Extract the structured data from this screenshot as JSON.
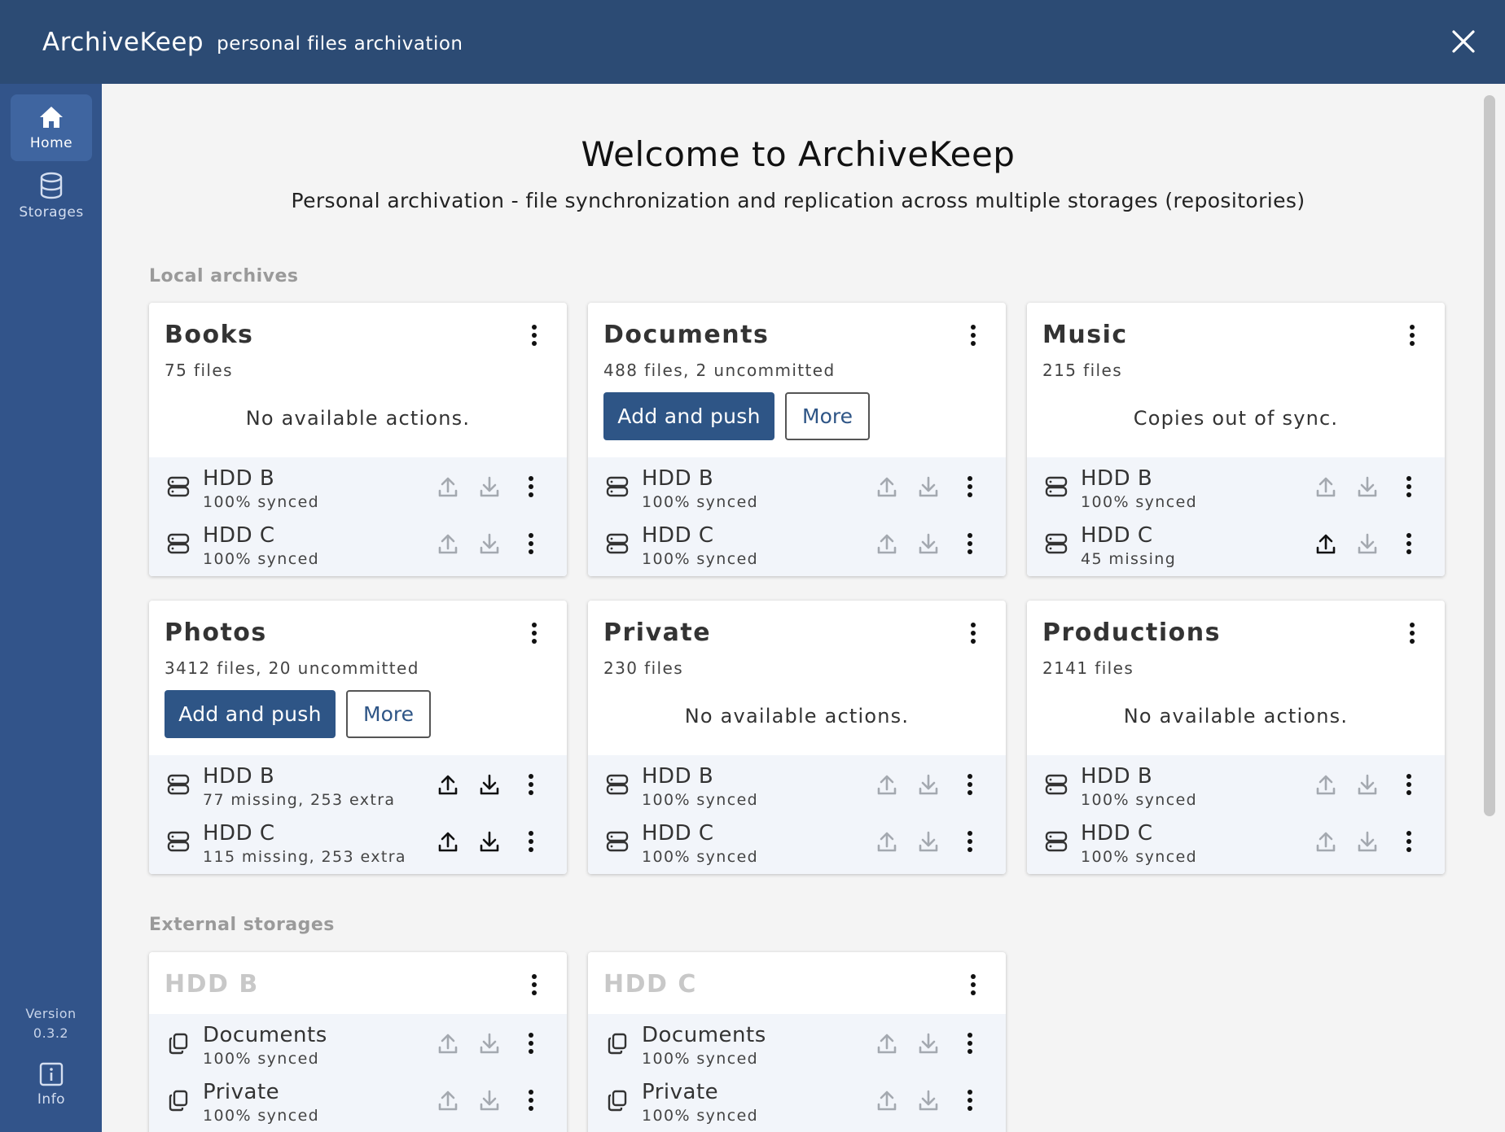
{
  "app": {
    "name": "ArchiveKeep",
    "subtitle": "personal files archivation"
  },
  "sidebar": {
    "items": [
      {
        "label": "Home",
        "icon": "home-icon",
        "active": true
      },
      {
        "label": "Storages",
        "icon": "database-icon",
        "active": false
      }
    ],
    "version_label": "Version",
    "version_value": "0.3.2",
    "info_label": "Info"
  },
  "main": {
    "welcome": "Welcome to ArchiveKeep",
    "subtitle": "Personal archivation - file synchronization and replication across multiple storages (repositories)",
    "local_section": "Local archives",
    "external_section": "External storages"
  },
  "archives": [
    {
      "title": "Books",
      "count": "75 files",
      "message": "No available actions.",
      "rows": [
        {
          "name": "HDD B",
          "status": "100% synced",
          "active": false
        },
        {
          "name": "HDD C",
          "status": "100% synced",
          "active": false
        }
      ]
    },
    {
      "title": "Documents",
      "count": "488 files, 2 uncommitted",
      "primary": "Add and push",
      "secondary": "More",
      "rows": [
        {
          "name": "HDD B",
          "status": "100% synced",
          "active": false
        },
        {
          "name": "HDD C",
          "status": "100% synced",
          "active": false
        }
      ]
    },
    {
      "title": "Music",
      "count": "215 files",
      "message": "Copies out of sync.",
      "rows": [
        {
          "name": "HDD B",
          "status": "100% synced",
          "active": false
        },
        {
          "name": "HDD C",
          "status": "45 missing",
          "active": "up"
        }
      ]
    },
    {
      "title": "Photos",
      "count": "3412 files, 20 uncommitted",
      "primary": "Add and push",
      "secondary": "More",
      "rows": [
        {
          "name": "HDD B",
          "status": "77 missing, 253 extra",
          "active": "both"
        },
        {
          "name": "HDD C",
          "status": "115 missing, 253 extra",
          "active": "both"
        }
      ]
    },
    {
      "title": "Private",
      "count": "230 files",
      "message": "No available actions.",
      "rows": [
        {
          "name": "HDD B",
          "status": "100% synced",
          "active": false
        },
        {
          "name": "HDD C",
          "status": "100% synced",
          "active": false
        }
      ]
    },
    {
      "title": "Productions",
      "count": "2141 files",
      "message": "No available actions.",
      "rows": [
        {
          "name": "HDD B",
          "status": "100% synced",
          "active": false
        },
        {
          "name": "HDD C",
          "status": "100% synced",
          "active": false
        }
      ]
    }
  ],
  "storages": [
    {
      "title": "HDD B",
      "rows": [
        {
          "name": "Documents",
          "status": "100% synced",
          "active": false
        },
        {
          "name": "Private",
          "status": "100% synced",
          "active": false
        }
      ]
    },
    {
      "title": "HDD C",
      "rows": [
        {
          "name": "Documents",
          "status": "100% synced",
          "active": false
        },
        {
          "name": "Private",
          "status": "100% synced",
          "active": false
        }
      ]
    }
  ],
  "colors": {
    "titlebar": "#2c4b74",
    "sidebar": "#32548a",
    "primary": "#2e5586",
    "row_bg": "#f2f5fa"
  }
}
